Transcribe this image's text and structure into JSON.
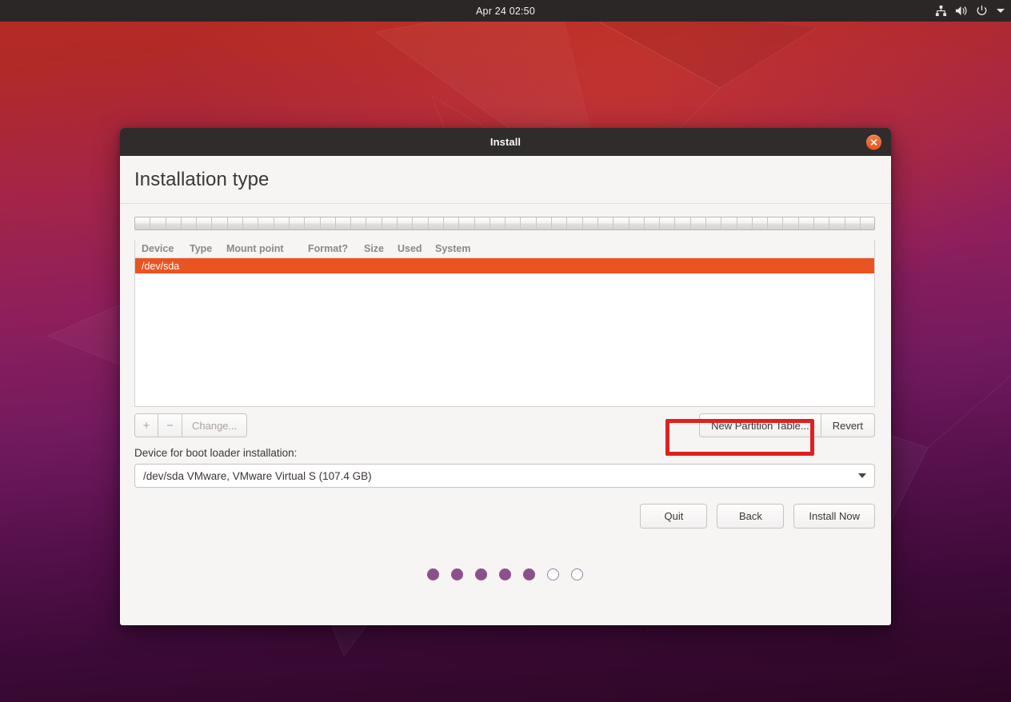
{
  "topbar": {
    "clock": "Apr 24  02:50",
    "tray": [
      {
        "icon": "network-icon",
        "name": "network-icon"
      },
      {
        "icon": "volume-icon",
        "name": "volume-icon"
      },
      {
        "icon": "power-icon",
        "name": "power-icon"
      },
      {
        "icon": "chevron-down-icon",
        "name": "system-menu-caret"
      }
    ]
  },
  "window": {
    "title": "Install",
    "close_label": "✕",
    "page_title": "Installation type"
  },
  "partition_strip": {
    "segments": 48
  },
  "table": {
    "headers": [
      "Device",
      "Type",
      "Mount point",
      "Format?",
      "Size",
      "Used",
      "System"
    ],
    "rows": [
      {
        "device": "/dev/sda",
        "type": "",
        "mount_point": "",
        "format": "",
        "size": "",
        "used": "",
        "system": "",
        "selected": true
      }
    ],
    "selected_color": "#e95420"
  },
  "toolbar": {
    "add_label": "+",
    "remove_label": "−",
    "change_label": "Change...",
    "new_partition_table_label": "New Partition Table...",
    "revert_label": "Revert"
  },
  "boot_loader": {
    "label": "Device for boot loader installation:",
    "selected": "/dev/sda VMware, VMware Virtual S (107.4 GB)"
  },
  "nav": {
    "quit_label": "Quit",
    "back_label": "Back",
    "install_label": "Install Now"
  },
  "progress_dots": {
    "total": 7,
    "filled": 5,
    "filled_color": "#8e4f8e"
  },
  "annotation": {
    "color": "#e02020",
    "target": "New Partition Table..."
  }
}
